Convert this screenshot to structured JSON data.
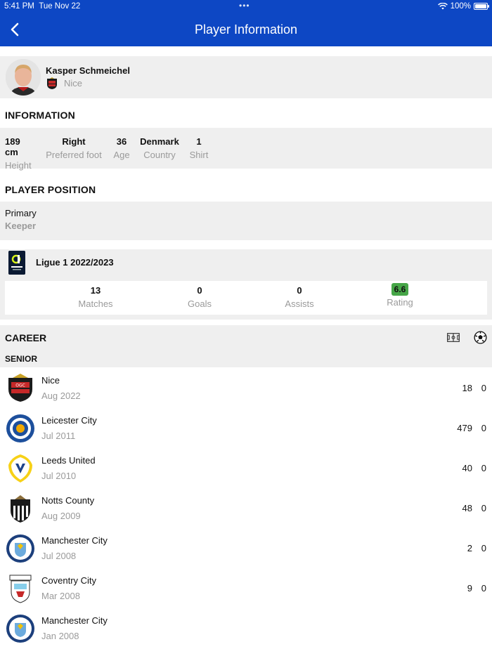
{
  "status_bar": {
    "time": "5:41 PM",
    "date": "Tue Nov 22",
    "battery": "100%"
  },
  "nav": {
    "title": "Player Information"
  },
  "player": {
    "name": "Kasper Schmeichel",
    "club": "Nice"
  },
  "information": {
    "title": "INFORMATION",
    "items": [
      {
        "value": "189 cm",
        "label": "Height"
      },
      {
        "value": "Right",
        "label": "Preferred foot"
      },
      {
        "value": "36",
        "label": "Age"
      },
      {
        "value": "Denmark",
        "label": "Country"
      },
      {
        "value": "1",
        "label": "Shirt"
      }
    ]
  },
  "position": {
    "title": "PLAYER POSITION",
    "key": "Primary",
    "value": "Keeper"
  },
  "league": {
    "name": "Ligue 1 2022/2023",
    "stats": [
      {
        "value": "13",
        "label": "Matches"
      },
      {
        "value": "0",
        "label": "Goals"
      },
      {
        "value": "0",
        "label": "Assists"
      },
      {
        "value": "6.6",
        "label": "Rating"
      }
    ]
  },
  "career": {
    "title": "CAREER",
    "subtitle": "SENIOR",
    "rows": [
      {
        "club": "Nice",
        "date": "Aug 2022",
        "apps": "18",
        "goals": "0"
      },
      {
        "club": "Leicester City",
        "date": "Jul 2011",
        "apps": "479",
        "goals": "0"
      },
      {
        "club": "Leeds United",
        "date": "Jul 2010",
        "apps": "40",
        "goals": "0"
      },
      {
        "club": "Notts County",
        "date": "Aug 2009",
        "apps": "48",
        "goals": "0"
      },
      {
        "club": "Manchester City",
        "date": "Jul 2008",
        "apps": "2",
        "goals": "0"
      },
      {
        "club": "Coventry City",
        "date": "Mar 2008",
        "apps": "9",
        "goals": "0"
      },
      {
        "club": "Manchester City",
        "date": "Jan 2008",
        "apps": "",
        "goals": ""
      }
    ]
  },
  "colors": {
    "nav_blue": "#0d47c4",
    "rating_green": "#46a647",
    "panel_gray": "#efefef"
  }
}
